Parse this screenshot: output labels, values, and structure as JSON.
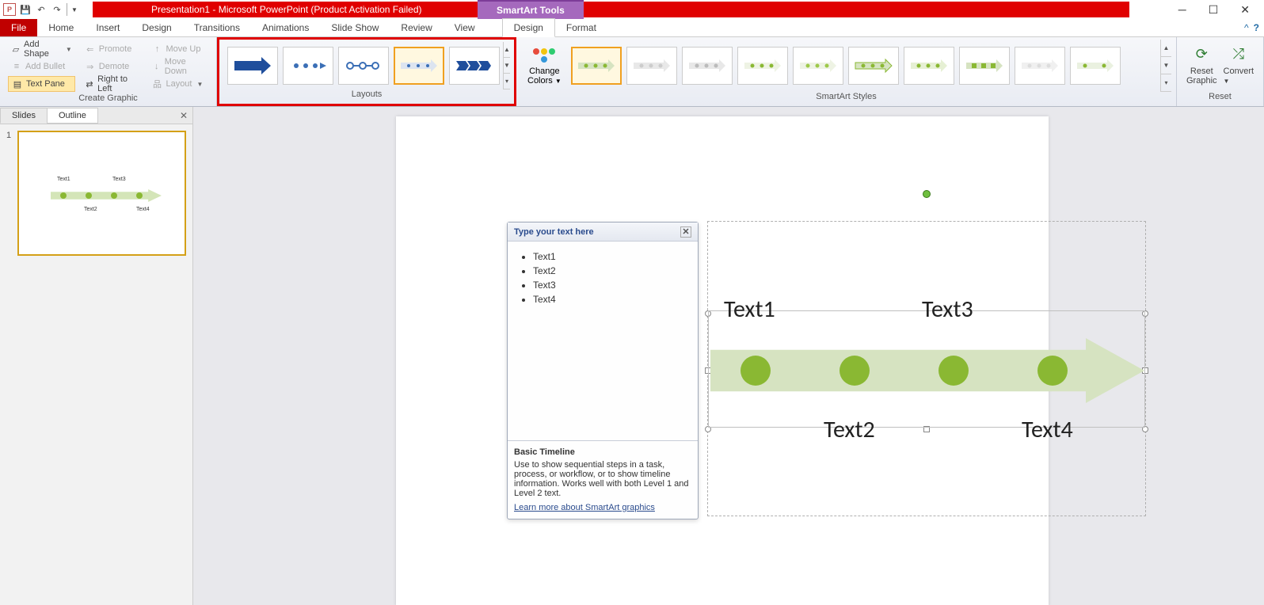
{
  "titlebar": {
    "title": "Presentation1 - Microsoft PowerPoint (Product Activation Failed)",
    "smartart_tools": "SmartArt Tools"
  },
  "tabs": {
    "file": "File",
    "home": "Home",
    "insert": "Insert",
    "design": "Design",
    "transitions": "Transitions",
    "animations": "Animations",
    "slideshow": "Slide Show",
    "review": "Review",
    "view": "View",
    "sa_design": "Design",
    "sa_format": "Format"
  },
  "ribbon": {
    "create_graphic": {
      "add_shape": "Add Shape",
      "add_bullet": "Add Bullet",
      "text_pane": "Text Pane",
      "promote": "Promote",
      "demote": "Demote",
      "rtl": "Right to Left",
      "move_up": "Move Up",
      "move_down": "Move Down",
      "layout": "Layout",
      "group_label": "Create Graphic"
    },
    "layouts": {
      "group_label": "Layouts"
    },
    "change_colors": {
      "label_line1": "Change",
      "label_line2": "Colors"
    },
    "styles": {
      "group_label": "SmartArt Styles"
    },
    "reset": {
      "reset_graphic": "Reset\nGraphic",
      "convert": "Convert",
      "group_label": "Reset"
    }
  },
  "left_panel": {
    "tab_slides": "Slides",
    "tab_outline": "Outline",
    "slide_number": "1"
  },
  "textpane": {
    "header": "Type your text here",
    "items": [
      "Text1",
      "Text2",
      "Text3",
      "Text4"
    ],
    "info_title": "Basic Timeline",
    "info_body": "Use to show sequential steps in a task, process, or workflow, or to show timeline information. Works well with both Level 1 and Level 2 text.",
    "info_link": "Learn more about SmartArt graphics"
  },
  "smartart": {
    "t1": "Text1",
    "t2": "Text2",
    "t3": "Text3",
    "t4": "Text4"
  }
}
